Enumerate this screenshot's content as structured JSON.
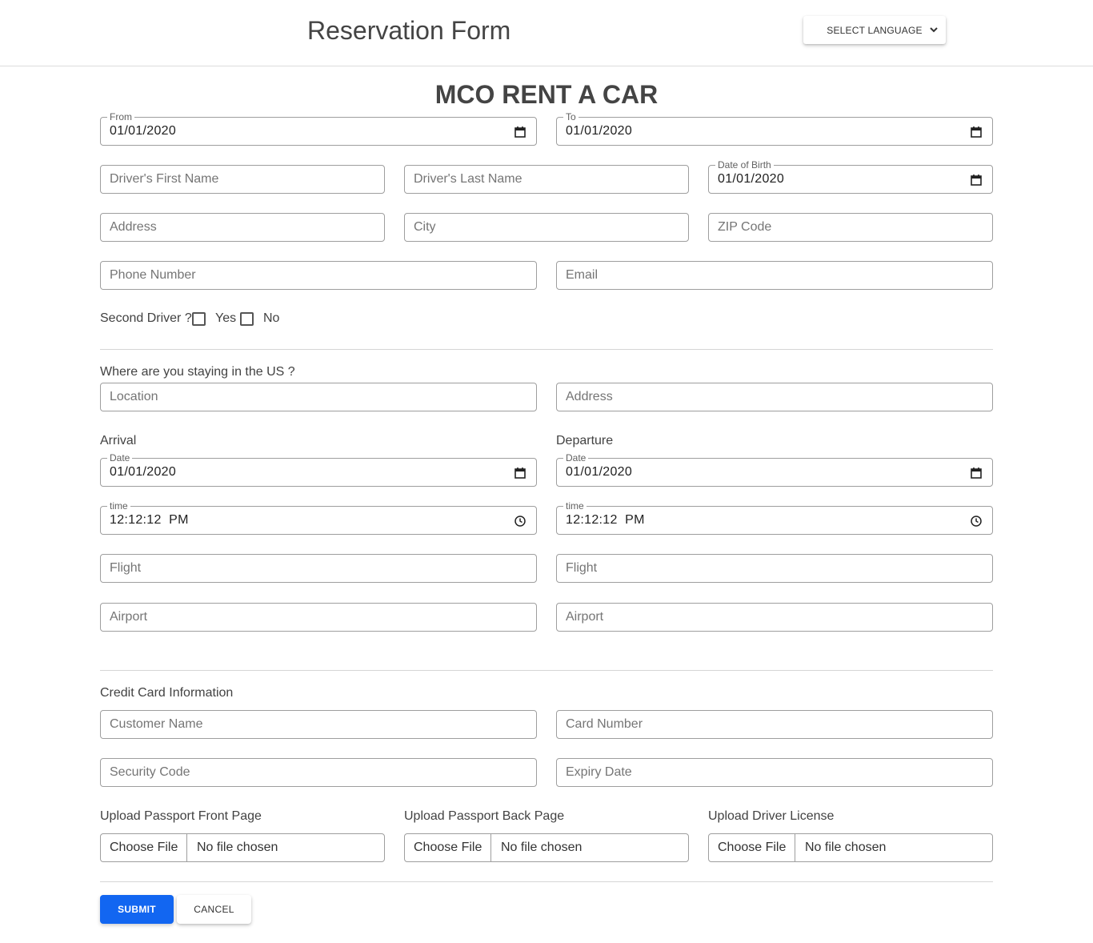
{
  "header": {
    "title": "Reservation Form",
    "language_select": "SELECT LANGUAGE"
  },
  "page_title": "MCO RENT A CAR",
  "rental": {
    "from_label": "From",
    "from_value": "01/01/2020",
    "to_label": "To",
    "to_value": "01/01/2020"
  },
  "driver": {
    "first_name_placeholder": "Driver's First Name",
    "last_name_placeholder": "Driver's Last Name",
    "dob_label": "Date of Birth",
    "dob_value": "01/01/2020",
    "address_placeholder": "Address",
    "city_placeholder": "City",
    "zip_placeholder": "ZIP Code",
    "phone_placeholder": "Phone Number",
    "email_placeholder": "Email"
  },
  "second_driver": {
    "label": "Second Driver ?",
    "yes_label": "Yes",
    "no_label": "No"
  },
  "stay": {
    "label": "Where are you staying in the US ?",
    "location_placeholder": "Location",
    "address_placeholder": "Address"
  },
  "arrival": {
    "heading": "Arrival",
    "date_label": "Date",
    "date_value": "01/01/2020",
    "time_label": "time",
    "time_value": "12:12:12  PM",
    "flight_placeholder": "Flight",
    "airport_placeholder": "Airport"
  },
  "departure": {
    "heading": "Departure",
    "date_label": "Date",
    "date_value": "01/01/2020",
    "time_label": "time",
    "time_value": "12:12:12  PM",
    "flight_placeholder": "Flight",
    "airport_placeholder": "Airport"
  },
  "credit_card": {
    "heading": "Credit Card Information",
    "customer_name_placeholder": "Customer Name",
    "card_number_placeholder": "Card Number",
    "security_code_placeholder": "Security Code",
    "expiry_placeholder": "Expiry Date"
  },
  "uploads": [
    {
      "label": "Upload Passport Front Page",
      "button": "Choose File",
      "status": "No file chosen"
    },
    {
      "label": "Upload Passport Back Page",
      "button": "Choose File",
      "status": "No file chosen"
    },
    {
      "label": "Upload Driver License",
      "button": "Choose File",
      "status": "No file chosen"
    }
  ],
  "actions": {
    "submit_label": "SUBMIT",
    "cancel_label": "CANCEL"
  },
  "icons": {
    "date": "calendar-icon",
    "time": "clock-icon",
    "dropdown": "chevron-down-icon"
  }
}
